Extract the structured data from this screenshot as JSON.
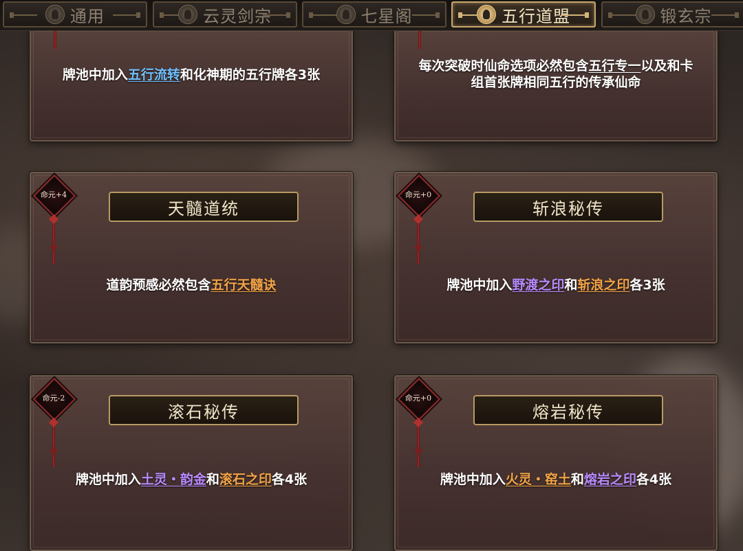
{
  "tabs": [
    {
      "label": "通用",
      "icon": "lotus-icon",
      "active": false
    },
    {
      "label": "云灵剑宗",
      "icon": "cloud-icon",
      "active": false
    },
    {
      "label": "七星阁",
      "icon": "pagoda-icon",
      "active": false
    },
    {
      "label": "五行道盟",
      "icon": "five-elements-icon",
      "active": true
    },
    {
      "label": "锻玄宗",
      "icon": "flame-icon",
      "active": false
    }
  ],
  "cards": [
    {
      "title": "",
      "badge": "",
      "desc": {
        "pre": "牌池中加入",
        "kw1": "五行流转",
        "mid": "和化神期的五行牌各3张",
        "kw2": "",
        "post": ""
      }
    },
    {
      "title": "",
      "badge": "",
      "desc": {
        "pre": "每次突破时仙命选项必然包含",
        "kw1": "五行专一",
        "mid": "以及和卡组首张牌相同五行的传承仙命",
        "kw2": "",
        "post": ""
      }
    },
    {
      "title": "天髓道统",
      "badge": "命元+4",
      "desc": {
        "pre": "道韵预感必然包含",
        "kw1": "五行天髓诀",
        "mid": "",
        "kw2": "",
        "post": ""
      }
    },
    {
      "title": "斩浪秘传",
      "badge": "命元+0",
      "desc": {
        "pre": "牌池中加入",
        "kw1": "野渡之印",
        "mid": "和",
        "kw2": "斩浪之印",
        "post": "各3张"
      }
    },
    {
      "title": "滚石秘传",
      "badge": "命元-2",
      "desc": {
        "pre": "牌池中加入",
        "kw1": "土灵・韵金",
        "mid": "和",
        "kw2": "滚石之印",
        "post": "各4张"
      }
    },
    {
      "title": "熔岩秘传",
      "badge": "命元+0",
      "desc": {
        "pre": "牌池中加入",
        "kw1": "火灵・窑土",
        "mid": "和",
        "kw2": "熔岩之印",
        "post": "各4张"
      }
    }
  ],
  "colors": {
    "keyword_blue": "#6fc0ff",
    "keyword_orange": "#f3a447",
    "keyword_purple": "#b98bff",
    "keyword_green": "#7fe07a",
    "active_tab_border": "#c9a86a"
  }
}
